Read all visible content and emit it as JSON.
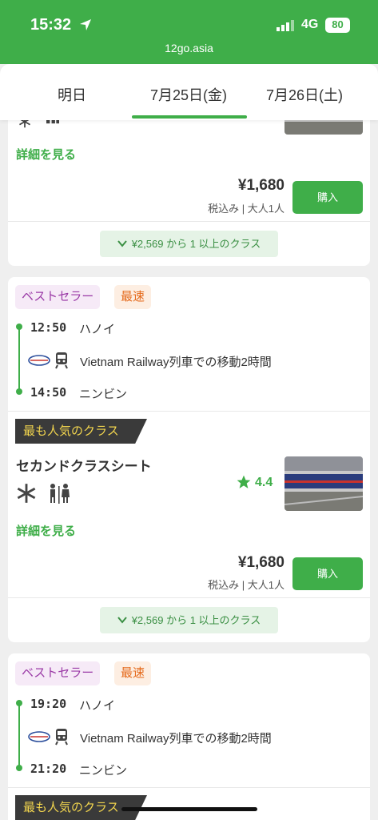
{
  "status": {
    "time": "15:32",
    "network": "4G",
    "battery": "80",
    "url": "12go.asia"
  },
  "tabs": [
    "明日",
    "7月25日(金)",
    "7月26日(土)"
  ],
  "colors": {
    "primary": "#3fae49",
    "bestseller": "#9a3aa6",
    "fastest": "#e56b1d",
    "popular_text": "#f2d54e"
  },
  "card0": {
    "details": "詳細を見る",
    "price": "¥1,680",
    "price_note": "税込み | 大人1人",
    "buy": "購入",
    "more": "¥2,569 から 1 以上のクラス"
  },
  "card1": {
    "badges": [
      "ベストセラー",
      "最速"
    ],
    "dep_time": "12:50",
    "dep_station": "ハノイ",
    "route": "Vietnam Railway列車での移動2時間",
    "arr_time": "14:50",
    "arr_station": "ニンビン",
    "popular": "最も人気のクラス",
    "class_name": "セカンドクラスシート",
    "rating": "4.4",
    "amenities": [
      "snowflake-icon",
      "restroom-icon"
    ],
    "details": "詳細を見る",
    "price": "¥1,680",
    "price_note": "税込み | 大人1人",
    "buy": "購入",
    "more": "¥2,569 から 1 以上のクラス"
  },
  "card2": {
    "badges": [
      "ベストセラー",
      "最速"
    ],
    "dep_time": "19:20",
    "dep_station": "ハノイ",
    "route": "Vietnam Railway列車での移動2時間",
    "arr_time": "21:20",
    "arr_station": "ニンビン",
    "popular": "最も人気のクラス"
  }
}
